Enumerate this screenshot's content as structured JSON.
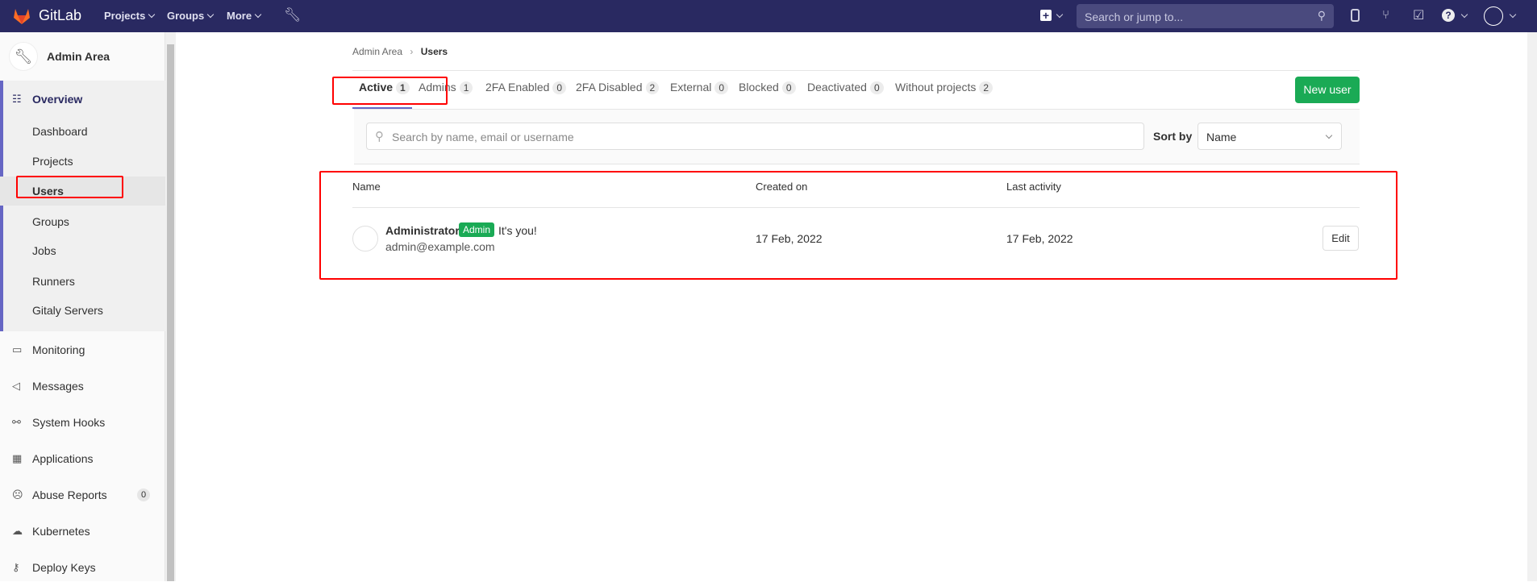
{
  "topbar": {
    "brand": "GitLab",
    "nav": [
      "Projects",
      "Groups",
      "More"
    ],
    "search_placeholder": "Search or jump to...",
    "icons": [
      "plus-icon",
      "search-icon",
      "issues-icon",
      "merge-request-icon",
      "todo-icon",
      "help-icon",
      "avatar"
    ]
  },
  "sidebar": {
    "title": "Admin Area",
    "overview": "Overview",
    "sub": [
      "Dashboard",
      "Projects",
      "Users",
      "Groups",
      "Jobs",
      "Runners",
      "Gitaly Servers"
    ],
    "items": [
      {
        "label": "Monitoring",
        "icon": "monitor-icon"
      },
      {
        "label": "Messages",
        "icon": "megaphone-icon"
      },
      {
        "label": "System Hooks",
        "icon": "hook-icon"
      },
      {
        "label": "Applications",
        "icon": "grid-icon"
      },
      {
        "label": "Abuse Reports",
        "icon": "abuse-icon",
        "count": "0"
      },
      {
        "label": "Kubernetes",
        "icon": "kubernetes-icon"
      },
      {
        "label": "Deploy Keys",
        "icon": "key-icon"
      }
    ]
  },
  "breadcrumb": {
    "parent": "Admin Area",
    "current": "Users"
  },
  "tabs": [
    {
      "label": "Active",
      "count": "1"
    },
    {
      "label": "Admins",
      "count": "1"
    },
    {
      "label": "2FA Enabled",
      "count": "0"
    },
    {
      "label": "2FA Disabled",
      "count": "2"
    },
    {
      "label": "External",
      "count": "0"
    },
    {
      "label": "Blocked",
      "count": "0"
    },
    {
      "label": "Deactivated",
      "count": "0"
    },
    {
      "label": "Without projects",
      "count": "2"
    }
  ],
  "new_user": "New user",
  "filter": {
    "search_placeholder": "Search by name, email or username",
    "sort_label": "Sort by",
    "sort_value": "Name"
  },
  "table": {
    "headers": [
      "Name",
      "Created on",
      "Last activity"
    ],
    "rows": [
      {
        "name": "Administrator",
        "badge": "Admin",
        "note": "It's you!",
        "email": "admin@example.com",
        "created": "17 Feb, 2022",
        "last_activity": "17 Feb, 2022",
        "action": "Edit"
      }
    ]
  },
  "colors": {
    "topbar": "#292961",
    "accent": "#6666c4",
    "success": "#1aaa55",
    "annotation": "#ff0000"
  }
}
